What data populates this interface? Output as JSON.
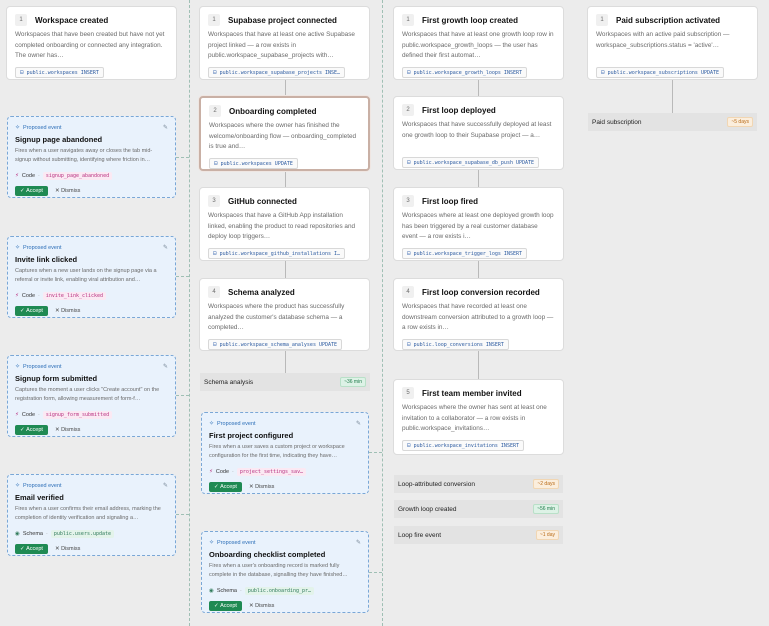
{
  "columns": [
    {
      "cards": [
        {
          "num": "1",
          "title": "Workspace created",
          "desc": "Workspaces that have been created but have not yet completed onboarding or connected any integration. The owner has…",
          "tag": "public.workspaces INSERT"
        }
      ],
      "proposed": [
        {
          "label": "Proposed event",
          "title": "Signup page abandoned",
          "desc": "Fires when a user navigates away or closes the tab mid-signup without submitting, identifying where friction in…",
          "kind": "Code",
          "value": "signup_page_abandoned",
          "accept": "Accept",
          "dismiss": "Dismiss"
        },
        {
          "label": "Proposed event",
          "title": "Invite link clicked",
          "desc": "Captures when a new user lands on the signup page via a referral or invite link, enabling viral attribution and…",
          "kind": "Code",
          "value": "invite_link_clicked",
          "accept": "Accept",
          "dismiss": "Dismiss"
        },
        {
          "label": "Proposed event",
          "title": "Signup form submitted",
          "desc": "Captures the moment a user clicks \"Create account\" on the registration form, allowing measurement of form-f…",
          "kind": "Code",
          "value": "signup_form_submitted",
          "accept": "Accept",
          "dismiss": "Dismiss"
        },
        {
          "label": "Proposed event",
          "title": "Email verified",
          "desc": "Fires when a user confirms their email address, marking the completion of identity verification and signaling a…",
          "kind": "Schema",
          "value": "public.users.update",
          "accept": "Accept",
          "dismiss": "Dismiss"
        }
      ]
    },
    {
      "cards": [
        {
          "num": "1",
          "title": "Supabase project connected",
          "desc": "Workspaces that have at least one active Supabase project linked — a row exists in public.workspace_supabase_projects with…",
          "tag": "public.workspace_supabase_projects INSE…"
        },
        {
          "num": "2",
          "title": "Onboarding completed",
          "desc": "Workspaces where the owner has finished the welcome/onboarding flow — onboarding_completed is true and…",
          "tag": "public.workspaces UPDATE"
        },
        {
          "num": "3",
          "title": "GitHub connected",
          "desc": "Workspaces that have a GitHub App installation linked, enabling the product to read repositories and deploy loop triggers…",
          "tag": "public.workspace_github_installations I…"
        },
        {
          "num": "4",
          "title": "Schema analyzed",
          "desc": "Workspaces where the product has successfully analyzed the customer's database schema — a completed…",
          "tag": "public.workspace_schema_analyses UPDATE"
        }
      ],
      "stages": [
        {
          "name": "Schema analysis",
          "badge": "~36 min"
        }
      ],
      "proposed": [
        {
          "label": "Proposed event",
          "title": "First project configured",
          "desc": "Fires when a user saves a custom project or workspace configuration for the first time, indicating they have…",
          "kind": "Code",
          "value": "project_settings_sav…",
          "accept": "Accept",
          "dismiss": "Dismiss"
        },
        {
          "label": "Proposed event",
          "title": "Onboarding checklist completed",
          "desc": "Fires when a user's onboarding record is marked fully complete in the database, signalling they have finished…",
          "kind": "Schema",
          "value": "public.onboarding_pr…",
          "accept": "Accept",
          "dismiss": "Dismiss"
        }
      ]
    },
    {
      "cards": [
        {
          "num": "1",
          "title": "First growth loop created",
          "desc": "Workspaces that have at least one growth loop row in public.workspace_growth_loops — the user has defined their first automat…",
          "tag": "public.workspace_growth_loops INSERT"
        },
        {
          "num": "2",
          "title": "First loop deployed",
          "desc": "Workspaces that have successfully deployed at least one growth loop to their Supabase project — a…",
          "tag": "public.workspace_supabase_db_push UPDATE"
        },
        {
          "num": "3",
          "title": "First loop fired",
          "desc": "Workspaces where at least one deployed growth loop has been triggered by a real customer database event — a row exists i…",
          "tag": "public.workspace_trigger_logs INSERT"
        },
        {
          "num": "4",
          "title": "First loop conversion recorded",
          "desc": "Workspaces that have recorded at least one downstream conversion attributed to a growth loop — a row exists in…",
          "tag": "public.loop_conversions INSERT"
        },
        {
          "num": "5",
          "title": "First team member invited",
          "desc": "Workspaces where the owner has sent at least one invitation to a collaborator — a row exists in public.workspace_invitations…",
          "tag": "public.workspace_invitations INSERT"
        }
      ],
      "stages": [
        {
          "name": "Loop-attributed conversion",
          "badge": "~2 days"
        },
        {
          "name": "Growth loop created",
          "badge": "~56 min"
        },
        {
          "name": "Loop fire event",
          "badge": "~1 day"
        }
      ]
    },
    {
      "cards": [
        {
          "num": "1",
          "title": "Paid subscription activated",
          "desc": "Workspaces with an active paid subscription — workspace_subscriptions.status = 'active'…",
          "tag": "public.workspace_subscriptions UPDATE"
        }
      ],
      "stages": [
        {
          "name": "Paid subscription",
          "badge": "~5 days"
        }
      ]
    }
  ],
  "colors": {
    "accent_green": "#1f8a53",
    "proposed_blue": "#2d6fb8",
    "badge_orange": "#b86a16",
    "badge_green": "#1f7a4a"
  },
  "icons": {
    "proposed": "sparkle-icon",
    "edit": "pencil-icon",
    "table": "table-icon",
    "code": "code-icon",
    "schema": "schema-icon",
    "accept": "check-icon",
    "dismiss": "close-icon"
  }
}
